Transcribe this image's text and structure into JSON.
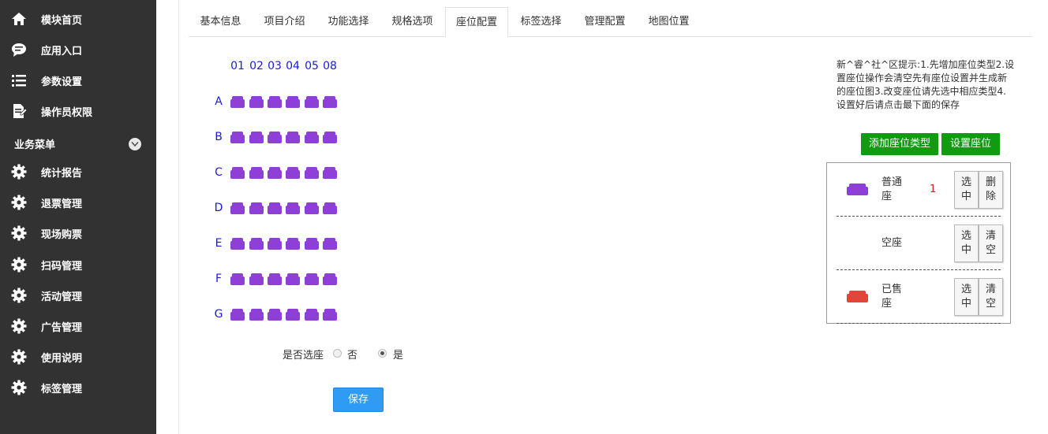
{
  "sidebar": {
    "items": [
      {
        "label": "模块首页",
        "icon": "home-icon"
      },
      {
        "label": "应用入口",
        "icon": "chat-bubble-icon"
      },
      {
        "label": "参数设置",
        "icon": "list-icon"
      },
      {
        "label": "操作员权限",
        "icon": "document-edit-icon"
      }
    ],
    "section_title": "业务菜单",
    "section_items": [
      {
        "label": "统计报告",
        "icon": "gear-icon"
      },
      {
        "label": "退票管理",
        "icon": "gear-icon"
      },
      {
        "label": "现场购票",
        "icon": "gear-icon"
      },
      {
        "label": "扫码管理",
        "icon": "gear-icon"
      },
      {
        "label": "活动管理",
        "icon": "gear-icon"
      },
      {
        "label": "广告管理",
        "icon": "gear-icon"
      },
      {
        "label": "使用说明",
        "icon": "gear-icon"
      },
      {
        "label": "标签管理",
        "icon": "gear-icon"
      }
    ]
  },
  "tabs": [
    {
      "label": "基本信息"
    },
    {
      "label": "项目介绍"
    },
    {
      "label": "功能选择"
    },
    {
      "label": "规格选项"
    },
    {
      "label": "座位配置",
      "active": true
    },
    {
      "label": "标签选择"
    },
    {
      "label": "管理配置"
    },
    {
      "label": "地图位置"
    }
  ],
  "seat_map": {
    "columns": [
      "01",
      "02",
      "03",
      "04",
      "05",
      "08"
    ],
    "rows": [
      "A",
      "B",
      "C",
      "D",
      "E",
      "F",
      "G"
    ],
    "seat_color": "#8d3fd6"
  },
  "select_seat": {
    "question": "是否选座",
    "option_no": "否",
    "option_yes": "是",
    "selected": "是"
  },
  "save_label": "保存",
  "hint_text": "新^睿^社^区提示:1.先增加座位类型2.设置座位操作会清空先有座位设置并生成新的座位图3.改变座位请先选中相应类型4.设置好后请点击最下面的保存",
  "buttons": {
    "add_type": "添加座位类型",
    "set_seat": "设置座位"
  },
  "seat_types": [
    {
      "name_line1": "普通",
      "name_line2": "座",
      "count": "1",
      "color": "#8d3fd6",
      "btn1_l1": "选",
      "btn1_l2": "中",
      "btn2_l1": "删",
      "btn2_l2": "除"
    },
    {
      "name_line1": "空座",
      "name_line2": "",
      "count": "",
      "color": "",
      "btn1_l1": "选",
      "btn1_l2": "中",
      "btn2_l1": "清",
      "btn2_l2": "空"
    },
    {
      "name_line1": "已售",
      "name_line2": "座",
      "count": "",
      "color": "#e0473a",
      "btn1_l1": "选",
      "btn1_l2": "中",
      "btn2_l1": "清",
      "btn2_l2": "空"
    }
  ],
  "colors": {
    "sidebar_bg": "#323232",
    "accent_green": "#129b12",
    "accent_blue": "#2f9bf4",
    "label_blue": "#1a1ae0"
  }
}
